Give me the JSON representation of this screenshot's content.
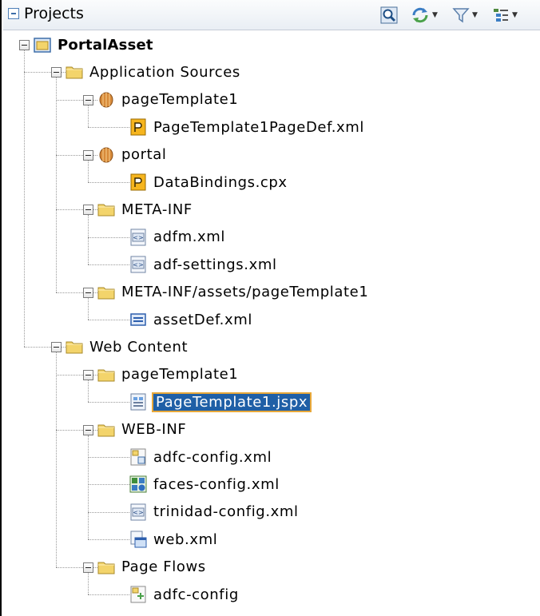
{
  "panel": {
    "title": "Projects",
    "toolbar": [
      "find-icon",
      "sync-icon",
      "filter-icon",
      "options-icon"
    ]
  },
  "tree": {
    "root": "PortalAsset",
    "nodes": [
      {
        "label": "Application Sources",
        "icon": "folder-icon"
      },
      {
        "label": "pageTemplate1",
        "icon": "package-icon"
      },
      {
        "label": "PageTemplate1PageDef.xml",
        "icon": "pagedef-file-icon"
      },
      {
        "label": "portal",
        "icon": "package-icon"
      },
      {
        "label": "DataBindings.cpx",
        "icon": "pagedef-file-icon"
      },
      {
        "label": "META-INF",
        "icon": "folder-icon"
      },
      {
        "label": "adfm.xml",
        "icon": "xml-file-icon"
      },
      {
        "label": "adf-settings.xml",
        "icon": "xml-file-icon"
      },
      {
        "label": "META-INF/assets/pageTemplate1",
        "icon": "folder-icon"
      },
      {
        "label": "assetDef.xml",
        "icon": "asset-def-icon"
      },
      {
        "label": "Web Content",
        "icon": "folder-icon"
      },
      {
        "label": "pageTemplate1",
        "icon": "folder-icon"
      },
      {
        "label": "PageTemplate1.jspx",
        "icon": "jspx-file-icon",
        "selected": true
      },
      {
        "label": "WEB-INF",
        "icon": "folder-icon"
      },
      {
        "label": "adfc-config.xml",
        "icon": "adfc-config-file-icon"
      },
      {
        "label": "faces-config.xml",
        "icon": "faces-config-icon"
      },
      {
        "label": "trinidad-config.xml",
        "icon": "xml-file-icon"
      },
      {
        "label": "web.xml",
        "icon": "web-xml-icon"
      },
      {
        "label": "Page Flows",
        "icon": "folder-icon"
      },
      {
        "label": "adfc-config",
        "icon": "task-flow-icon"
      }
    ]
  },
  "colors": {
    "selection": "#1f5fa6",
    "selection_border": "#e8a83a",
    "folder": "#f3d46b"
  }
}
